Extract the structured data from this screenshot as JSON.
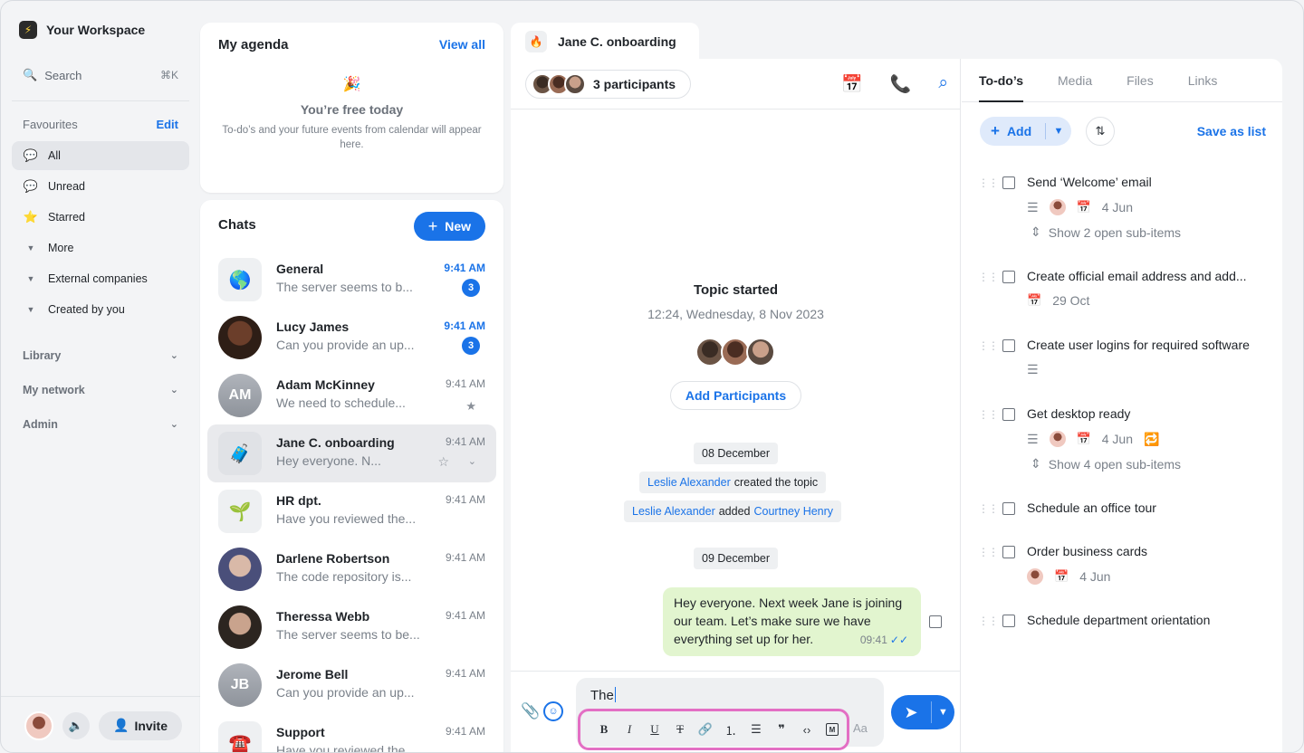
{
  "workspace": {
    "name": "Your Workspace",
    "logo_icon": "lightning-icon"
  },
  "search": {
    "label": "Search",
    "shortcut": "⌘K"
  },
  "favourites": {
    "heading": "Favourites",
    "edit": "Edit"
  },
  "nav": [
    {
      "label": "All",
      "icon": "chat-bubble-icon",
      "active": true
    },
    {
      "label": "Unread",
      "icon": "unread-bubble-icon"
    },
    {
      "label": "Starred",
      "icon": "star-icon"
    },
    {
      "label": "More",
      "icon": "caret-down-icon"
    },
    {
      "label": "External companies",
      "icon": "caret-down-icon"
    },
    {
      "label": "Created by you",
      "icon": "caret-down-icon"
    }
  ],
  "sections": [
    "Library",
    "My network",
    "Admin"
  ],
  "bottom": {
    "invite": "Invite"
  },
  "agenda": {
    "title": "My agenda",
    "view_all": "View all",
    "free_title": "You’re free today",
    "free_desc": "To-do’s and your future events from calendar will appear here."
  },
  "chats": {
    "title": "Chats",
    "new_label": "New",
    "items": [
      {
        "name": "General",
        "snippet": "The server seems to b...",
        "time": "9:41 AM",
        "unread": "3",
        "bold": true,
        "avatar": "🌎"
      },
      {
        "name": "Lucy James",
        "snippet": "Can you provide an up...",
        "time": "9:41 AM",
        "unread": "3",
        "bold": true
      },
      {
        "name": "Adam McKinney",
        "snippet": "We need to schedule...",
        "time": "9:41 AM",
        "initials": "AM",
        "starred": true
      },
      {
        "name": "Jane C. onboarding",
        "snippet": "Hey everyone. N...",
        "time": "9:41 AM",
        "avatar": "🧳",
        "active": true
      },
      {
        "name": "HR dpt.",
        "snippet": "Have you reviewed the...",
        "time": "9:41 AM",
        "avatar": "🌱"
      },
      {
        "name": "Darlene Robertson",
        "snippet": "The code repository is...",
        "time": "9:41 AM"
      },
      {
        "name": "Theressa Webb",
        "snippet": "The server seems to be...",
        "time": "9:41 AM"
      },
      {
        "name": "Jerome Bell",
        "snippet": "Can you provide an up...",
        "time": "9:41 AM",
        "initials": "JB"
      },
      {
        "name": "Support",
        "snippet": "Have you reviewed the...",
        "time": "9:41 AM",
        "avatar": "☎️"
      }
    ]
  },
  "conversation": {
    "tab_title": "Jane C. onboarding",
    "participants_label": "3 participants",
    "topic_title": "Topic started",
    "topic_date": "12:24, Wednesday, 8 Nov 2023",
    "add_participants": "Add Participants",
    "date1": "08 December",
    "sys1": {
      "actor": "Leslie Alexander",
      "action": "created the topic"
    },
    "sys2": {
      "actor": "Leslie Alexander",
      "action": "added",
      "target": "Courtney Henry"
    },
    "date2": "09 December",
    "message": {
      "text": "Hey everyone. Next week Jane is joining our team. Let’s make sure we have everything set up for her.",
      "time": "09:41"
    },
    "composer_text": "The",
    "composer_aa": "Aa"
  },
  "todo_panel": {
    "tabs": [
      "To-do’s",
      "Media",
      "Files",
      "Links"
    ],
    "add_label": "Add",
    "save_as_list": "Save as list",
    "items": [
      {
        "title": "Send ‘Welcome’ email",
        "date": "4 Jun",
        "sub": "Show 2 open sub-items"
      },
      {
        "title": "Create official email address and add...",
        "date": "29 Oct"
      },
      {
        "title": "Create user logins for required software"
      },
      {
        "title": "Get desktop ready",
        "date": "4 Jun",
        "sub": "Show 4 open sub-items"
      },
      {
        "title": "Schedule an office tour"
      },
      {
        "title": "Order business cards",
        "date": "4 Jun"
      },
      {
        "title": "Schedule department orientation"
      }
    ]
  },
  "colors": {
    "accent": "#1a73e8",
    "bubble": "#e2f5cf",
    "highlight": "#e36fc4"
  }
}
